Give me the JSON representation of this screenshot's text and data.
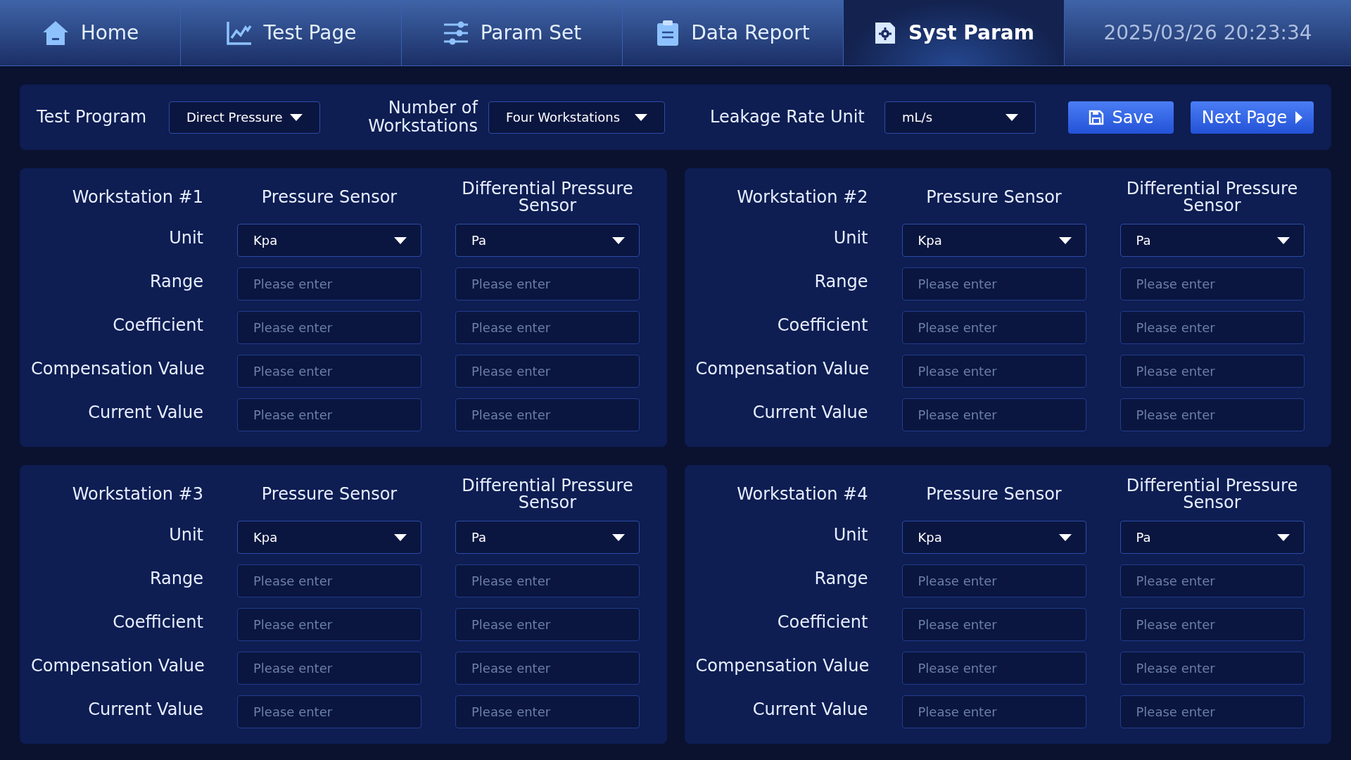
{
  "nav": {
    "tabs": [
      {
        "label": "Home",
        "selected": false
      },
      {
        "label": "Test Page",
        "selected": false
      },
      {
        "label": "Param Set",
        "selected": false
      },
      {
        "label": "Data Report",
        "selected": false
      },
      {
        "label": "Syst Param",
        "selected": true
      }
    ],
    "datetime": "2025/03/26 20:23:34"
  },
  "config": {
    "fields": [
      {
        "label": "Test Program",
        "value": "Direct Pressure"
      },
      {
        "label": "Number of Workstations",
        "value": "Four Workstations"
      },
      {
        "label": "Leakage Rate Unit",
        "value": "mL/s"
      }
    ],
    "buttons": [
      {
        "label": "Save",
        "kind": "save"
      },
      {
        "label": "Next Page",
        "kind": "next"
      }
    ]
  },
  "workstations": [
    {
      "title": "Workstation #1",
      "columns": [
        "Pressure Sensor",
        "Differential Pressure Sensor"
      ],
      "rows": [
        {
          "label": "Unit",
          "kind": "select",
          "cells": [
            {
              "value": "Kpa"
            },
            {
              "value": "Pa"
            }
          ]
        },
        {
          "label": "Range",
          "kind": "input",
          "cells": [
            {
              "placeholder": "Please enter"
            },
            {
              "placeholder": "Please enter"
            }
          ]
        },
        {
          "label": "Coefficient",
          "kind": "input",
          "cells": [
            {
              "placeholder": "Please enter"
            },
            {
              "placeholder": "Please enter"
            }
          ]
        },
        {
          "label": "Compensation Value",
          "kind": "input",
          "cells": [
            {
              "placeholder": "Please enter"
            },
            {
              "placeholder": "Please enter"
            }
          ]
        },
        {
          "label": "Current Value",
          "kind": "input",
          "cells": [
            {
              "placeholder": "Please enter"
            },
            {
              "placeholder": "Please enter"
            }
          ]
        }
      ]
    },
    {
      "title": "Workstation #2",
      "columns": [
        "Pressure Sensor",
        "Differential Pressure Sensor"
      ],
      "rows": [
        {
          "label": "Unit",
          "kind": "select",
          "cells": [
            {
              "value": "Kpa"
            },
            {
              "value": "Pa"
            }
          ]
        },
        {
          "label": "Range",
          "kind": "input",
          "cells": [
            {
              "placeholder": "Please enter"
            },
            {
              "placeholder": "Please enter"
            }
          ]
        },
        {
          "label": "Coefficient",
          "kind": "input",
          "cells": [
            {
              "placeholder": "Please enter"
            },
            {
              "placeholder": "Please enter"
            }
          ]
        },
        {
          "label": "Compensation Value",
          "kind": "input",
          "cells": [
            {
              "placeholder": "Please enter"
            },
            {
              "placeholder": "Please enter"
            }
          ]
        },
        {
          "label": "Current Value",
          "kind": "input",
          "cells": [
            {
              "placeholder": "Please enter"
            },
            {
              "placeholder": "Please enter"
            }
          ]
        }
      ]
    },
    {
      "title": "Workstation #3",
      "columns": [
        "Pressure Sensor",
        "Differential Pressure Sensor"
      ],
      "rows": [
        {
          "label": "Unit",
          "kind": "select",
          "cells": [
            {
              "value": "Kpa"
            },
            {
              "value": "Pa"
            }
          ]
        },
        {
          "label": "Range",
          "kind": "input",
          "cells": [
            {
              "placeholder": "Please enter"
            },
            {
              "placeholder": "Please enter"
            }
          ]
        },
        {
          "label": "Coefficient",
          "kind": "input",
          "cells": [
            {
              "placeholder": "Please enter"
            },
            {
              "placeholder": "Please enter"
            }
          ]
        },
        {
          "label": "Compensation Value",
          "kind": "input",
          "cells": [
            {
              "placeholder": "Please enter"
            },
            {
              "placeholder": "Please enter"
            }
          ]
        },
        {
          "label": "Current Value",
          "kind": "input",
          "cells": [
            {
              "placeholder": "Please enter"
            },
            {
              "placeholder": "Please enter"
            }
          ]
        }
      ]
    },
    {
      "title": "Workstation #4",
      "columns": [
        "Pressure Sensor",
        "Differential Pressure Sensor"
      ],
      "rows": [
        {
          "label": "Unit",
          "kind": "select",
          "cells": [
            {
              "value": "Kpa"
            },
            {
              "value": "Pa"
            }
          ]
        },
        {
          "label": "Range",
          "kind": "input",
          "cells": [
            {
              "placeholder": "Please enter"
            },
            {
              "placeholder": "Please enter"
            }
          ]
        },
        {
          "label": "Coefficient",
          "kind": "input",
          "cells": [
            {
              "placeholder": "Please enter"
            },
            {
              "placeholder": "Please enter"
            }
          ]
        },
        {
          "label": "Compensation Value",
          "kind": "input",
          "cells": [
            {
              "placeholder": "Please enter"
            },
            {
              "placeholder": "Please enter"
            }
          ]
        },
        {
          "label": "Current Value",
          "kind": "input",
          "cells": [
            {
              "placeholder": "Please enter"
            },
            {
              "placeholder": "Please enter"
            }
          ]
        }
      ]
    }
  ]
}
